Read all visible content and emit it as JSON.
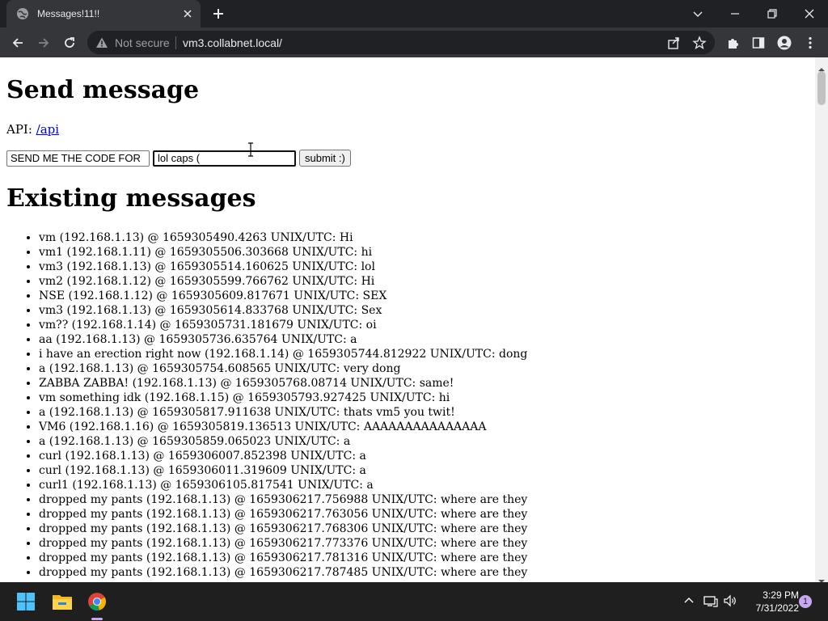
{
  "browser": {
    "tab_title": "Messages!11!!",
    "security_label": "Not secure",
    "url": "vm3.collabnet.local/"
  },
  "page": {
    "heading_send": "Send message",
    "api_label": "API:",
    "api_link": "/api",
    "subject_value": "SEND ME THE CODE FOR",
    "message_value": "lol caps (",
    "submit_label": "submit :)",
    "heading_existing": "Existing messages",
    "messages": [
      "vm (192.168.1.13) @ 1659305490.4263 UNIX/UTC: Hi",
      "vm1 (192.168.1.11) @ 1659305506.303668 UNIX/UTC: hi",
      "vm3 (192.168.1.13) @ 1659305514.160625 UNIX/UTC: lol",
      "vm2 (192.168.1.12) @ 1659305599.766762 UNIX/UTC: Hi",
      "NSE (192.168.1.12) @ 1659305609.817671 UNIX/UTC: SEX",
      "vm3 (192.168.1.13) @ 1659305614.833768 UNIX/UTC: Sex",
      "vm?? (192.168.1.14) @ 1659305731.181679 UNIX/UTC: oi",
      "aa (192.168.1.13) @ 1659305736.635764 UNIX/UTC: a",
      "i have an erection right now (192.168.1.14) @ 1659305744.812922 UNIX/UTC: dong",
      "a (192.168.1.13) @ 1659305754.608565 UNIX/UTC: very dong",
      "ZABBA ZABBA! (192.168.1.13) @ 1659305768.08714 UNIX/UTC: same!",
      "vm something idk (192.168.1.15) @ 1659305793.927425 UNIX/UTC: hi",
      "a (192.168.1.13) @ 1659305817.911638 UNIX/UTC: thats vm5 you twit!",
      "VM6 (192.168.1.16) @ 1659305819.136513 UNIX/UTC: AAAAAAAAAAAAAAA",
      "a (192.168.1.13) @ 1659305859.065023 UNIX/UTC: a",
      "curl (192.168.1.13) @ 1659306007.852398 UNIX/UTC: a",
      "curl (192.168.1.13) @ 1659306011.319609 UNIX/UTC: a",
      "curl1 (192.168.1.13) @ 1659306105.817541 UNIX/UTC: a",
      "dropped my pants (192.168.1.13) @ 1659306217.756988 UNIX/UTC: where are they",
      "dropped my pants (192.168.1.13) @ 1659306217.763056 UNIX/UTC: where are they",
      "dropped my pants (192.168.1.13) @ 1659306217.768306 UNIX/UTC: where are they",
      "dropped my pants (192.168.1.13) @ 1659306217.773376 UNIX/UTC: where are they",
      "dropped my pants (192.168.1.13) @ 1659306217.781316 UNIX/UTC: where are they",
      "dropped my pants (192.168.1.13) @ 1659306217.787485 UNIX/UTC: where are they"
    ]
  },
  "taskbar": {
    "time": "3:29 PM",
    "date": "7/31/2022",
    "notification_count": "1"
  },
  "colors": {
    "title_bar": "#202124",
    "toolbar": "#35363a",
    "link": "#0000ee",
    "taskbar": "#1f1f1f",
    "accent": "#c7a8f0"
  },
  "icons": [
    "globe-icon",
    "close-icon",
    "plus-icon",
    "chevron-down-icon",
    "minimize-icon",
    "restore-icon",
    "back-icon",
    "forward-icon",
    "reload-icon",
    "warning-icon",
    "share-icon",
    "star-icon",
    "extensions-icon",
    "side-panel-icon",
    "profile-icon",
    "menu-icon",
    "windows-start-icon",
    "file-explorer-icon",
    "chrome-icon",
    "chevron-up-icon",
    "network-icon",
    "volume-icon"
  ]
}
